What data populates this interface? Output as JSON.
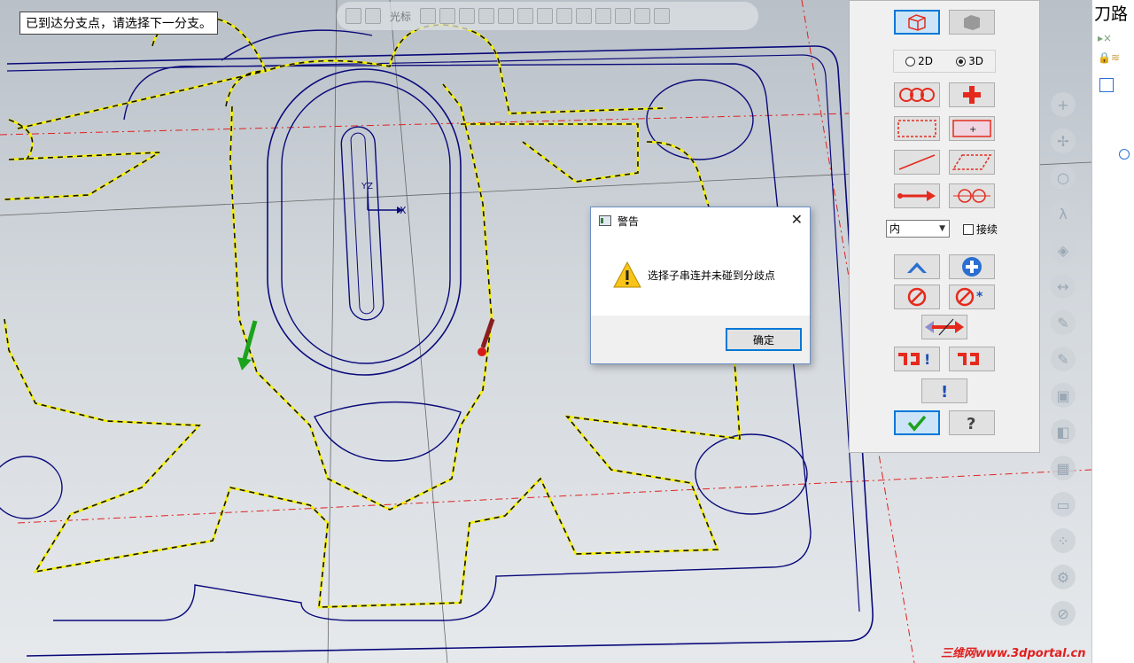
{
  "status": {
    "message": "已到达分支点，请选择下一分支。"
  },
  "toolbar": {
    "cursor_label": "光标"
  },
  "viewport": {
    "axis_x": "X",
    "axis_yz": "YZ"
  },
  "chain_panel": {
    "mode_2d": "2D",
    "mode_3d": "3D",
    "selected_mode": "3D",
    "mode_select": {
      "value": "内"
    },
    "chain_continue_label": "接续"
  },
  "dialog": {
    "title": "警告",
    "message": "选择子串连并未碰到分歧点",
    "ok_label": "确定"
  },
  "tree_panel": {
    "title": "刀路"
  },
  "watermark": "三维网www.3dportal.cn",
  "colors": {
    "chain_yellow": "#f5f000",
    "wire_blue": "#0a0a7a",
    "accent_red": "#e52a1d",
    "dialog_border": "#0078d7"
  }
}
